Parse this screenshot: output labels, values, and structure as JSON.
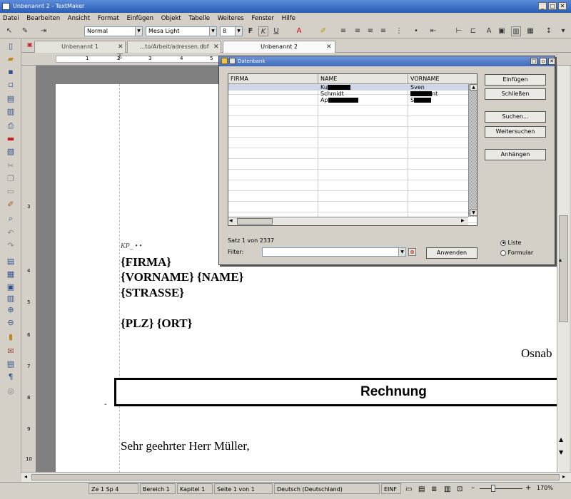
{
  "window": {
    "title": "Unbenannt 2 - TextMaker",
    "btn_min": "_",
    "btn_max": "□",
    "btn_close": "✕"
  },
  "menu": [
    "Datei",
    "Bearbeiten",
    "Ansicht",
    "Format",
    "Einfügen",
    "Objekt",
    "Tabelle",
    "Weiteres",
    "Fenster",
    "Hilfe"
  ],
  "toolbar": {
    "style": "Normal",
    "font": "Mesa Light",
    "size": "8",
    "font_color": "#cc0000",
    "highlight": "#f2e34a"
  },
  "tabs": [
    {
      "label": "Unbenannt 1",
      "close": "✕"
    },
    {
      "label": "...to/Arbeit/adressen.dbf",
      "close": "✕"
    },
    {
      "label": "Unbenannt 2",
      "close": "✕"
    }
  ],
  "ruler": {
    "marks": [
      "1",
      "2",
      "3",
      "4",
      "5"
    ]
  },
  "vruler": {
    "marks": [
      "3",
      "4",
      "5",
      "6",
      "7",
      "8",
      "9",
      "10"
    ]
  },
  "document": {
    "field_label": "KP_",
    "field_firma": "{FIRMA}",
    "field_vorname_name": "{VORNAME} {NAME}",
    "field_strasse": "{STRASSE}",
    "field_plz_ort": "{PLZ} {ORT}",
    "city": "Osnab",
    "heading": "Rechnung",
    "greeting": "Sehr geehrter Herr Müller,"
  },
  "dialog": {
    "title": "Datenbank",
    "columns": [
      "FIRMA",
      "NAME",
      "VORNAME"
    ],
    "rows": [
      {
        "firma": "",
        "name": "Ku",
        "vorname": "Sven"
      },
      {
        "firma": "",
        "name": "Schmidt",
        "vorname": "nt"
      },
      {
        "firma": "",
        "name": "Ap",
        "vorname": "S"
      }
    ],
    "buttons": {
      "insert": "Einfügen",
      "close": "Schließen",
      "search": "Suchen...",
      "search_next": "Weitersuchen",
      "append": "Anhängen",
      "apply": "Anwenden"
    },
    "record_info": "Satz 1 von 2337",
    "filter_label": "Filter:",
    "filter_value": "",
    "view_options": [
      {
        "label": "Liste",
        "selected": true
      },
      {
        "label": "Formular",
        "selected": false
      }
    ]
  },
  "status": {
    "position": "Ze 1 Sp 4",
    "section": "Bereich 1",
    "chapter": "Kapitel 1",
    "page": "Seite 1 von 1",
    "language": "Deutsch (Deutschland)",
    "mode": "EINF",
    "zoom": "170%"
  }
}
